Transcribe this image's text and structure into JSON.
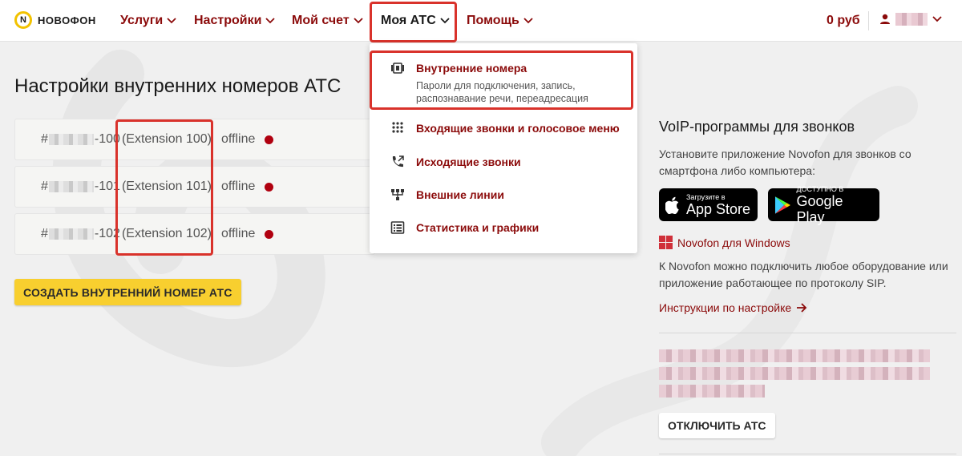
{
  "header": {
    "logo_text": "НОВОФОН",
    "logo_mark": "N",
    "nav": [
      {
        "label": "Услуги"
      },
      {
        "label": "Настройки"
      },
      {
        "label": "Мой счет"
      },
      {
        "label": "Моя АТС"
      },
      {
        "label": "Помощь"
      }
    ],
    "balance": "0 руб"
  },
  "main": {
    "title": "Настройки внутренних номеров АТС",
    "extensions": [
      {
        "hash": "#",
        "num": "-100",
        "label": "(Extension 100)",
        "status": "offline"
      },
      {
        "hash": "#",
        "num": "-101",
        "label": "(Extension 101)",
        "status": "offline"
      },
      {
        "hash": "#",
        "num": "-102",
        "label": "(Extension 102)",
        "status": "offline"
      }
    ],
    "create_button": "СОЗДАТЬ ВНУТРЕННИЙ НОМЕР АТС"
  },
  "dropdown": {
    "items": [
      {
        "label": "Внутренние номера",
        "desc": "Пароли для подключения, запись, распознавание речи, переадресация",
        "icon": "extensions-icon"
      },
      {
        "label": "Входящие звонки и голосовое меню",
        "icon": "dialpad-icon"
      },
      {
        "label": "Исходящие звонки",
        "icon": "outgoing-call-icon"
      },
      {
        "label": "Внешние линии",
        "icon": "network-icon"
      },
      {
        "label": "Статистика и графики",
        "icon": "statistics-icon"
      }
    ]
  },
  "sidebar": {
    "title": "VoIP-программы для звонков",
    "intro": "Установите приложение Novofon для звонков со смартфона либо компьютера:",
    "app_store_small": "Загрузите в",
    "app_store_big": "App Store",
    "google_play_small": "ДОСТУПНО В",
    "google_play_big": "Google Play",
    "windows_link": "Novofon для Windows",
    "sip_text": "К Novofon можно подключить любое оборудование или приложение работающее по протоколу SIP.",
    "instructions_link": "Инструкции по настройке",
    "disable_button": "ОТКЛЮЧИТЬ АТС"
  },
  "colors": {
    "brand_dark_red": "#8b0a0a",
    "accent_yellow": "#f8cf2f",
    "highlight_red": "#d9322b",
    "status_offline": "#b0000f"
  }
}
